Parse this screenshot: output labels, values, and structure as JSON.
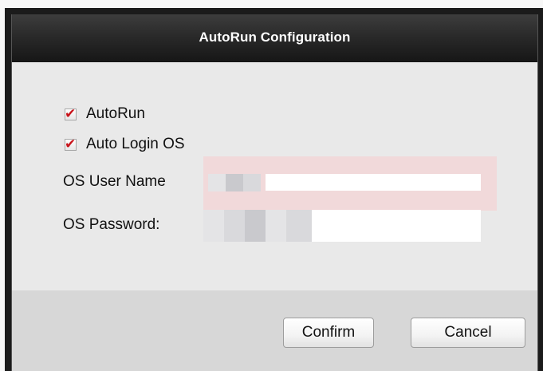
{
  "dialog": {
    "title": "AutoRun Configuration"
  },
  "options": {
    "autorun_label": "AutoRun",
    "autorun_checked": true,
    "auto_login_label": "Auto Login OS",
    "auto_login_checked": true
  },
  "fields": {
    "username_label": "OS User Name",
    "username_value": "",
    "password_label": "OS Password:",
    "password_value": ""
  },
  "buttons": {
    "confirm_label": "Confirm",
    "cancel_label": "Cancel"
  },
  "colors": {
    "title_bar": "#1f1f1f",
    "checkmark": "#c8141b",
    "body": "#e9e9e9",
    "footer": "#d7d7d7"
  },
  "icons": {
    "checkbox_mark": "checkmark-icon"
  }
}
